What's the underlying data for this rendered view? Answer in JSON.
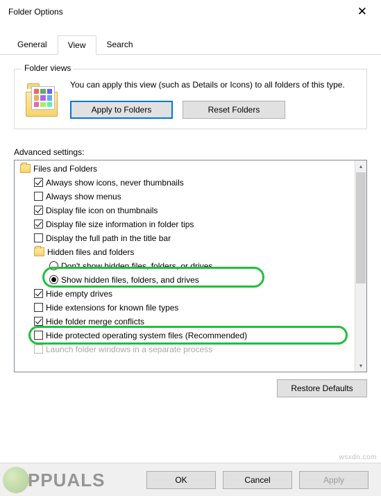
{
  "window": {
    "title": "Folder Options"
  },
  "tabs": {
    "general": "General",
    "view": "View",
    "search": "Search"
  },
  "folder_views": {
    "group_label": "Folder views",
    "description": "You can apply this view (such as Details or Icons) to all folders of this type.",
    "apply_btn": "Apply to Folders",
    "reset_btn": "Reset Folders"
  },
  "advanced": {
    "label": "Advanced settings:",
    "root": "Files and Folders",
    "hidden_group": "Hidden files and folders",
    "items": {
      "always_icons": "Always show icons, never thumbnails",
      "always_menus": "Always show menus",
      "file_icon_thumb": "Display file icon on thumbnails",
      "file_size_tips": "Display file size information in folder tips",
      "full_path_title": "Display the full path in the title bar",
      "dont_show_hidden": "Don't show hidden files, folders, or drives",
      "show_hidden": "Show hidden files, folders, and drives",
      "hide_empty": "Hide empty drives",
      "hide_ext": "Hide extensions for known file types",
      "hide_merge": "Hide folder merge conflicts",
      "hide_protected": "Hide protected operating system files (Recommended)",
      "launch_sep": "Launch folder windows in a separate process"
    },
    "restore_btn": "Restore Defaults"
  },
  "buttons": {
    "ok": "OK",
    "cancel": "Cancel",
    "apply": "Apply"
  },
  "watermark": "PPUALS",
  "credit": "wsxdn.com"
}
